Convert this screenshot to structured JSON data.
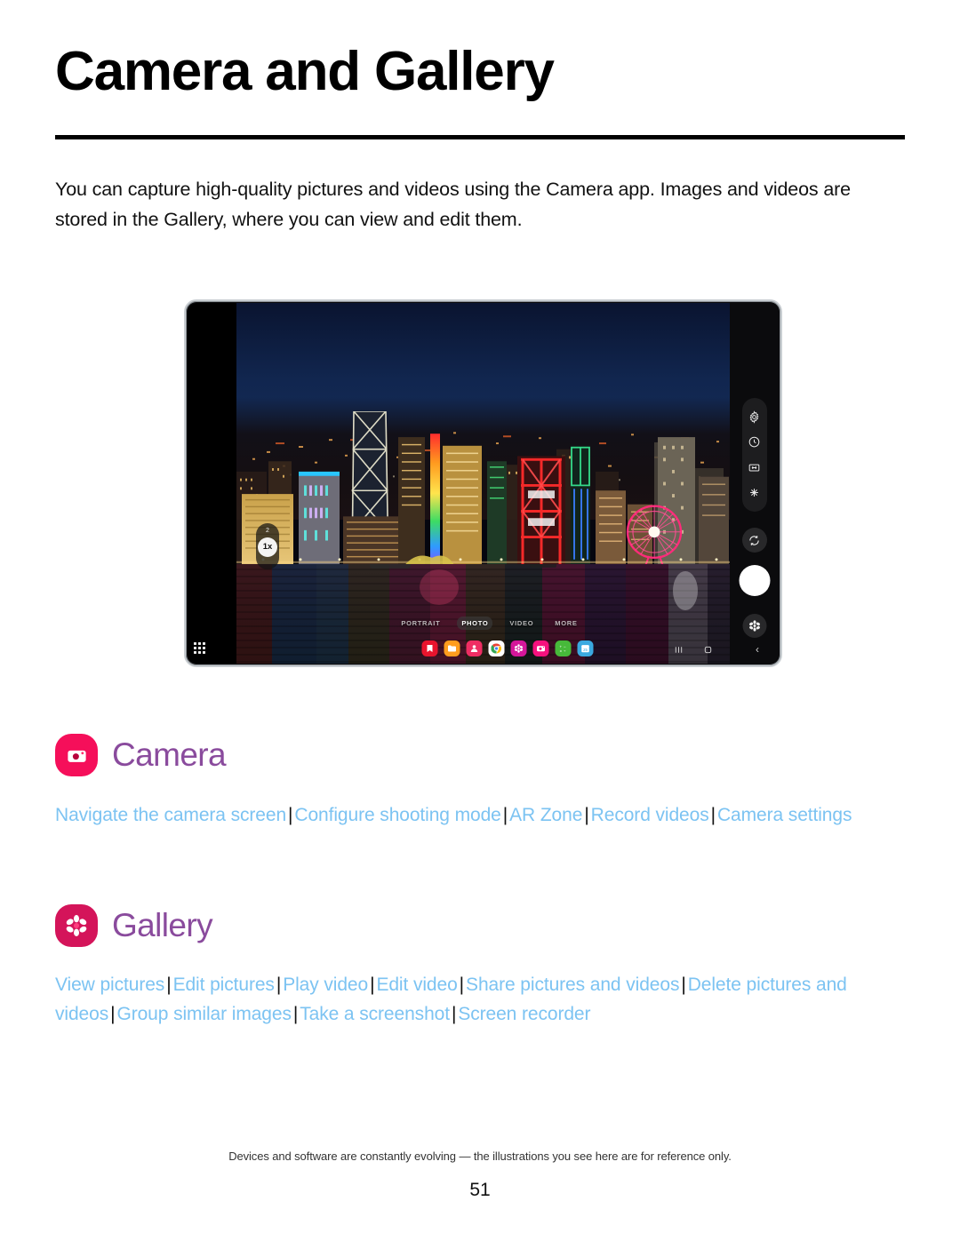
{
  "document": {
    "title": "Camera and Gallery",
    "intro": "You can capture high-quality pictures and videos using the Camera app. Images and videos are stored in the Gallery, where you can view and edit them.",
    "footnote": "Devices and software are constantly evolving — the illustrations you see here are for reference only.",
    "page_number": "51"
  },
  "colors": {
    "link": "#7cc3f2",
    "heading": "#8a4b9d",
    "camera_icon_bg": "#f50f5a",
    "gallery_icon_bg": "#d4145a",
    "rule": "#000000"
  },
  "sections": [
    {
      "id": "camera",
      "icon_name": "camera-app-icon",
      "name": "Camera",
      "links": [
        "Navigate the camera screen",
        "Configure shooting mode",
        "AR Zone",
        "Record videos",
        "Camera settings"
      ],
      "separator": "|"
    },
    {
      "id": "gallery",
      "icon_name": "gallery-app-icon",
      "name": "Gallery",
      "links": [
        "View pictures",
        "Edit pictures",
        "Play video",
        "Edit video",
        "Share pictures and videos",
        "Delete pictures and videos",
        "Group similar images",
        "Take a screenshot",
        "Screen recorder"
      ],
      "separator": "|"
    }
  ],
  "device_illustration": {
    "device_type": "tablet",
    "app": "Camera",
    "scene_description": "Hong Kong harbour skyline at night",
    "zoom_control": {
      "level_above": "2",
      "current": "1x"
    },
    "modes": [
      {
        "label": "PORTRAIT",
        "active": false
      },
      {
        "label": "PHOTO",
        "active": true
      },
      {
        "label": "VIDEO",
        "active": false
      },
      {
        "label": "MORE",
        "active": false
      }
    ],
    "right_controls": [
      "settings-gear-icon",
      "timer-icon",
      "aspect-ratio-icon",
      "effects-sparkle-icon"
    ],
    "switch_camera_icon": "switch-camera-icon",
    "shutter_button": "shutter-button",
    "gallery_preview_icon": "gallery-flower-icon",
    "taskbar_apps": [
      "samsung-internet-icon",
      "my-files-icon",
      "contacts-icon",
      "chrome-icon",
      "gallery-icon",
      "camera-icon",
      "calculator-icon",
      "calendar-icon"
    ],
    "nav_buttons": [
      "recents-icon",
      "home-icon",
      "back-icon"
    ],
    "apps_grid_icon": "apps-grid-icon"
  }
}
